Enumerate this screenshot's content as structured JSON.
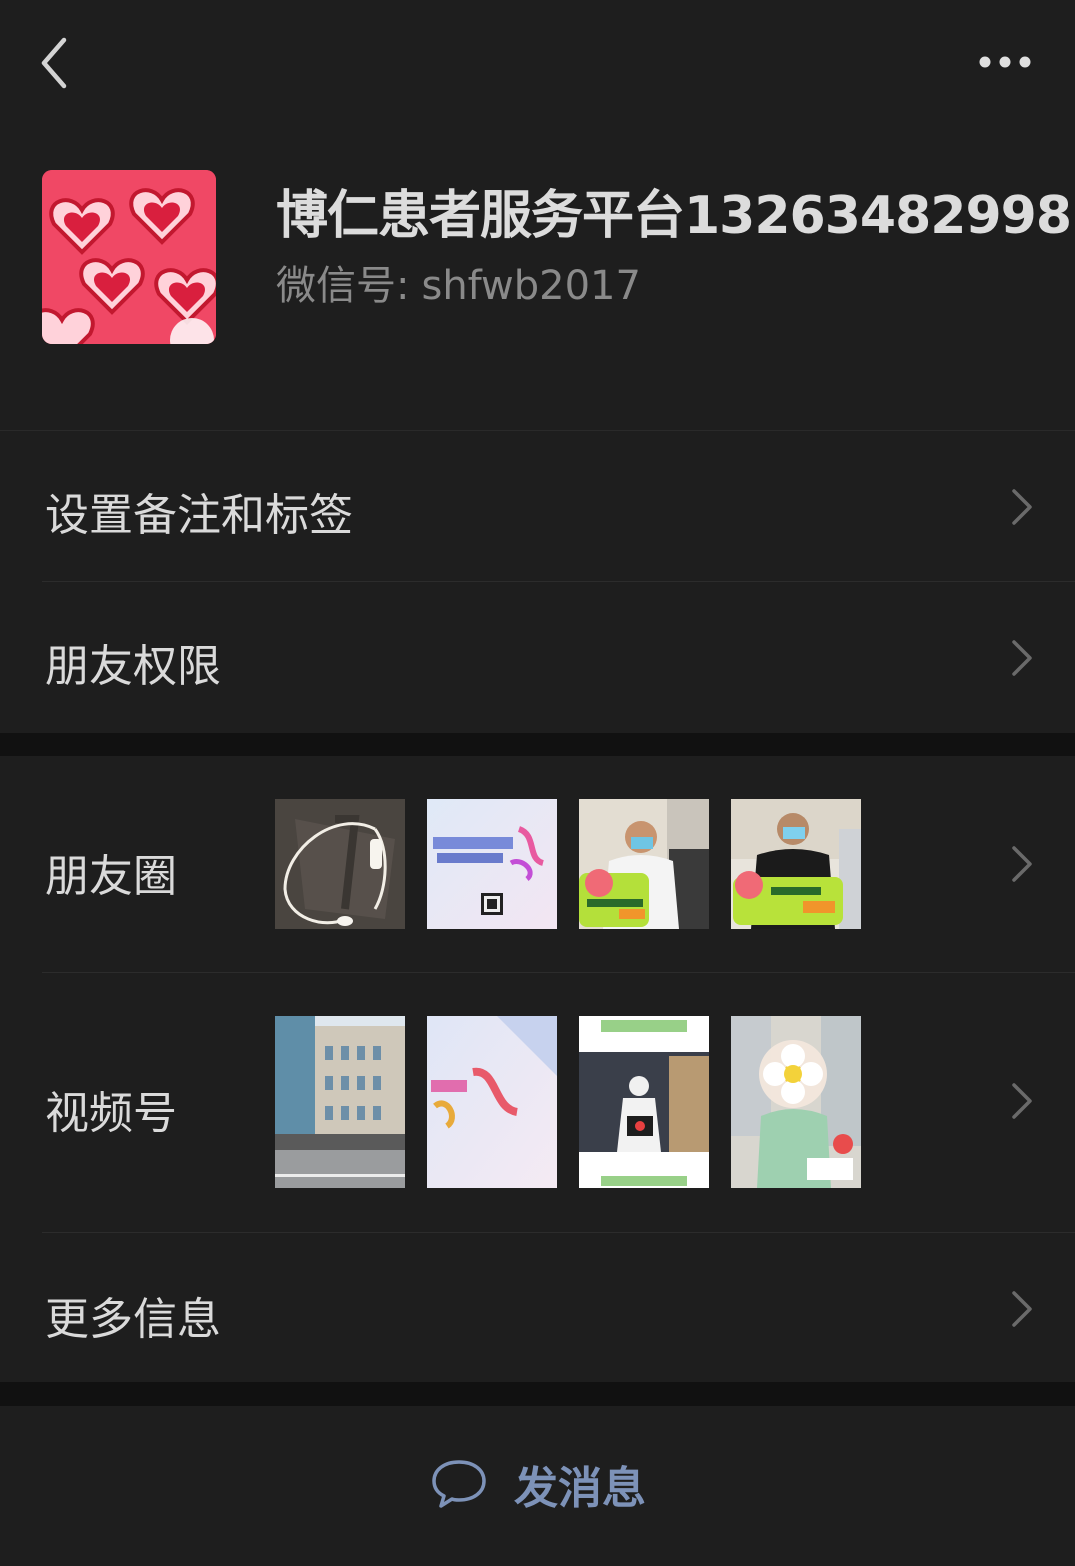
{
  "header": {
    "back_icon": "chevron-left-icon",
    "more_icon": "more-dots-icon"
  },
  "profile": {
    "name": "博仁患者服务平台13263482998",
    "wechat_id_label": "微信号:",
    "wechat_id": "shfwb2017",
    "avatar": "hearts-pattern-image"
  },
  "menu": {
    "remarks_tags": "设置备注和标签",
    "friend_permissions": "朋友权限",
    "moments": "朋友圈",
    "channels": "视频号",
    "more_info": "更多信息"
  },
  "moments_thumbs": [
    "earphones-photo",
    "medical-dream-poster",
    "donor-with-hero-sign-1",
    "donor-with-hero-sign-2"
  ],
  "channels_thumbs": [
    "hospital-building-photo",
    "dream-poster",
    "medic-night-photo",
    "child-with-flower-sticker"
  ],
  "bottom": {
    "send_message": "发消息",
    "send_icon": "chat-bubble-icon"
  },
  "colors": {
    "background": "#1e1e1e",
    "gap": "#111111",
    "accent": "#7d92b8"
  }
}
